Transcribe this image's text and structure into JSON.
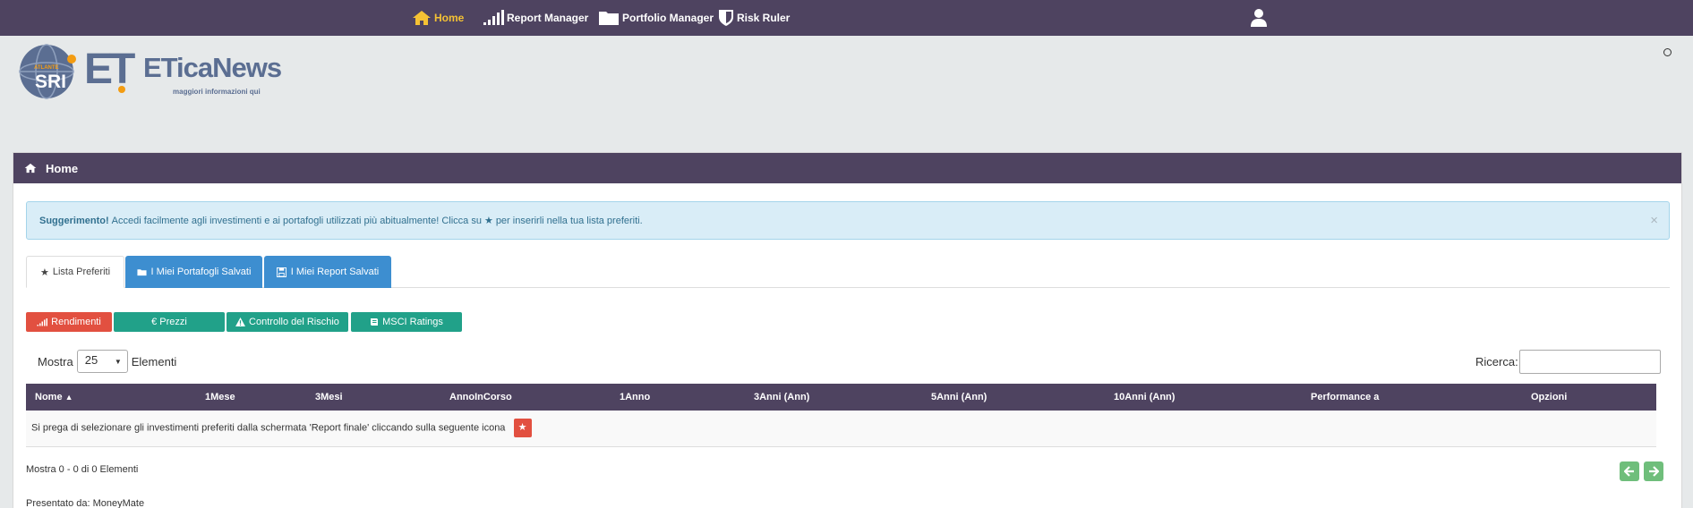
{
  "nav": {
    "home": "Home",
    "report_manager": "Report Manager",
    "portfolio_manager": "Portfolio Manager",
    "risk_ruler": "Risk Ruler",
    "active_color": "#f5c234",
    "bar_color": "#4e4360"
  },
  "logo": {
    "badge": "SRI",
    "badge_small": "ATLANTE",
    "mark": "ET",
    "name": "ETicaNews",
    "tagline": "maggiori informazioni qui"
  },
  "panel": {
    "title": "Home"
  },
  "alert": {
    "strong": "Suggerimento!",
    "text_before": "Accedi facilmente agli investimenti e ai portafogli utilizzati più abitualmente! Clicca su",
    "text_after": "per inserirli nella tua lista preferiti.",
    "close": "×"
  },
  "tabs": [
    {
      "label": "Lista Preferiti",
      "icon": "star-icon"
    },
    {
      "label": "I Miei Portafogli Salvati",
      "icon": "folder-icon"
    },
    {
      "label": "I Miei Report Salvati",
      "icon": "save-icon"
    }
  ],
  "buttons": {
    "rendimenti": "Rendimenti",
    "prezzi": "€ Prezzi",
    "rischio": "Controllo del Rischio",
    "msci": "MSCI Ratings"
  },
  "length": {
    "before": "Mostra",
    "value": "25",
    "after": "Elementi"
  },
  "search": {
    "label": "Ricerca:",
    "value": ""
  },
  "table": {
    "columns": [
      "Nome",
      "1Mese",
      "3Mesi",
      "AnnoInCorso",
      "1Anno",
      "3Anni (Ann)",
      "5Anni (Ann)",
      "10Anni (Ann)",
      "Performance a",
      "Opzioni"
    ],
    "empty_message": "Si prega di selezionare gli investimenti preferiti dalla schermata 'Report finale' cliccando sulla seguente icona"
  },
  "info": "Mostra 0 - 0 di 0 Elementi",
  "footer": "Presentato da: MoneyMate"
}
